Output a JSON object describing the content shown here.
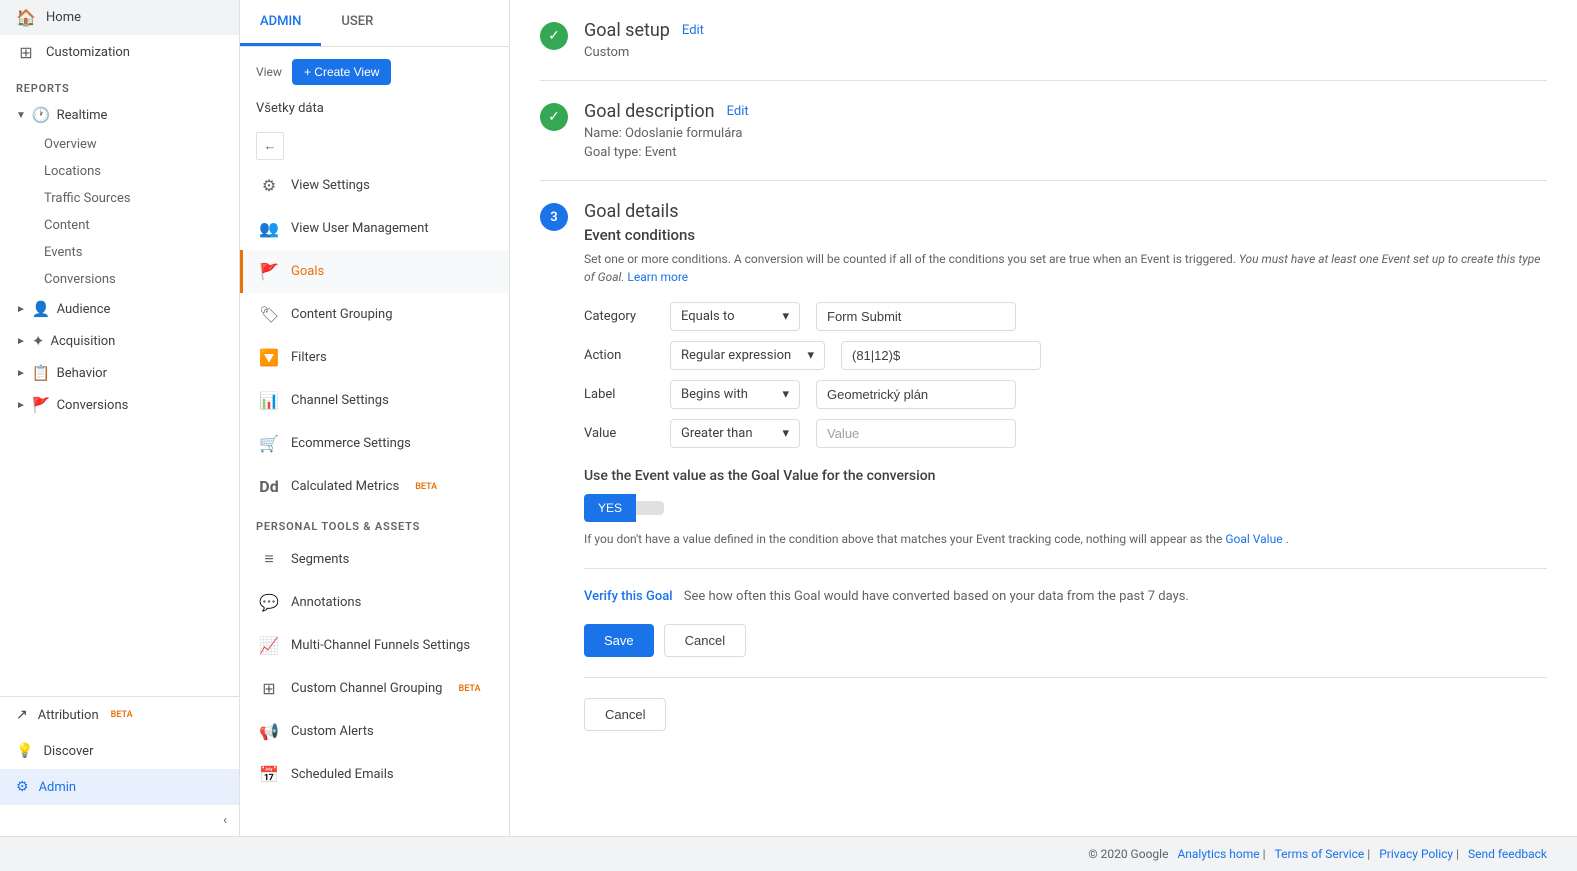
{
  "sidebar": {
    "home_label": "Home",
    "customization_label": "Customization",
    "reports_section": "REPORTS",
    "realtime_label": "Realtime",
    "overview_label": "Overview",
    "locations_label": "Locations",
    "traffic_sources_label": "Traffic Sources",
    "content_label": "Content",
    "events_label": "Events",
    "conversions_label": "Conversions",
    "audience_label": "Audience",
    "acquisition_label": "Acquisition",
    "behavior_label": "Behavior",
    "conversions2_label": "Conversions",
    "attribution_label": "Attribution",
    "attribution_beta": "BETA",
    "discover_label": "Discover",
    "admin_label": "Admin",
    "collapse_label": "‹"
  },
  "middle": {
    "admin_tab": "ADMIN",
    "user_tab": "USER",
    "view_label": "View",
    "create_view_btn": "+ Create View",
    "view_name": "Všetky dáta",
    "back_btn": "←",
    "nav_items": [
      {
        "label": "View Settings",
        "icon": "⚙"
      },
      {
        "label": "View User Management",
        "icon": "👥"
      },
      {
        "label": "Goals",
        "icon": "🚩",
        "active": true
      },
      {
        "label": "Content Grouping",
        "icon": "🏷"
      },
      {
        "label": "Filters",
        "icon": "🔽"
      },
      {
        "label": "Channel Settings",
        "icon": "📊"
      },
      {
        "label": "Ecommerce Settings",
        "icon": "🛒"
      },
      {
        "label": "Calculated Metrics",
        "icon": "Dd",
        "beta": "BETA"
      }
    ],
    "personal_tools_section": "PERSONAL TOOLS & ASSETS",
    "personal_items": [
      {
        "label": "Segments",
        "icon": "≡"
      },
      {
        "label": "Annotations",
        "icon": "💬"
      },
      {
        "label": "Multi-Channel Funnels Settings",
        "icon": "📈"
      },
      {
        "label": "Custom Channel Grouping",
        "icon": "🔲",
        "beta": "BETA"
      },
      {
        "label": "Custom Alerts",
        "icon": "📢"
      },
      {
        "label": "Scheduled Emails",
        "icon": "📅"
      }
    ]
  },
  "goal_setup": {
    "section1_title": "Goal setup",
    "section1_edit": "Edit",
    "section1_subtitle": "Custom",
    "section2_title": "Goal description",
    "section2_edit": "Edit",
    "section2_name_label": "Name:",
    "section2_name_value": "Odoslanie formulára",
    "section2_type_label": "Goal type:",
    "section2_type_value": "Event",
    "section3_title": "Goal details",
    "event_conditions_title": "Event conditions",
    "event_conditions_desc1": "Set one or more conditions. A conversion will be counted if all of the conditions you set are true when an Event is triggered.",
    "event_conditions_desc2": "You must have at least one Event set up to create this type of Goal.",
    "learn_more": "Learn more",
    "conditions": [
      {
        "label": "Category",
        "operator": "Equals to",
        "value": "Form Submit"
      },
      {
        "label": "Action",
        "operator": "Regular expression",
        "value": "(81|12)$"
      },
      {
        "label": "Label",
        "operator": "Begins with",
        "value": "Geometrický plán"
      },
      {
        "label": "Value",
        "operator": "Greater than",
        "value": "Value"
      }
    ],
    "goal_value_title": "Use the Event value as the Goal Value for the conversion",
    "toggle_yes": "YES",
    "toggle_no": "",
    "goal_value_desc1": "If you don't have a value defined in the condition above that matches your Event tracking code, nothing will appear as the",
    "goal_value_link": "Goal Value",
    "goal_value_desc2": ".",
    "verify_link": "Verify this Goal",
    "verify_text": "See how often this Goal would have converted based on your data from the past 7 days.",
    "save_btn": "Save",
    "cancel_btn": "Cancel",
    "cancel_bottom_btn": "Cancel"
  },
  "footer": {
    "copyright": "© 2020 Google",
    "analytics_home": "Analytics home",
    "terms": "Terms of Service",
    "privacy": "Privacy Policy",
    "feedback": "Send feedback"
  }
}
